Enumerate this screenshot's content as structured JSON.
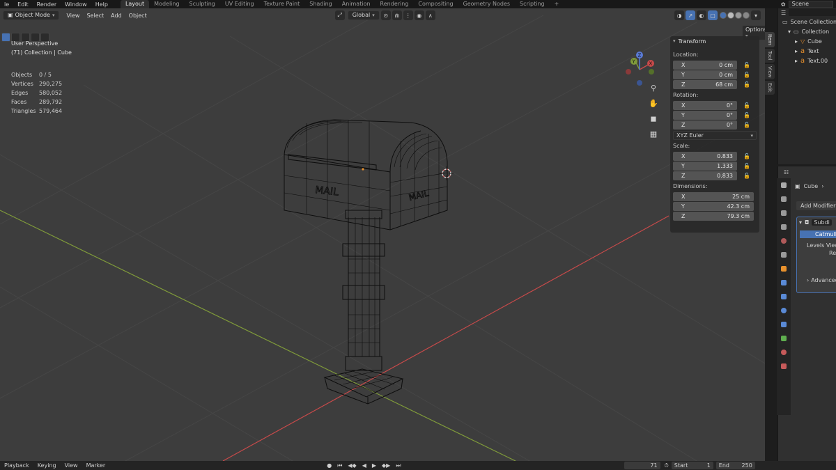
{
  "topbar": {
    "menus": [
      "le",
      "Edit",
      "Render",
      "Window",
      "Help"
    ],
    "workspaces": [
      "Layout",
      "Modeling",
      "Sculpting",
      "UV Editing",
      "Texture Paint",
      "Shading",
      "Animation",
      "Rendering",
      "Compositing",
      "Geometry Nodes",
      "Scripting"
    ],
    "active_workspace": "Layout",
    "add_tab": "+",
    "scene_label": "Scene"
  },
  "viewport_header": {
    "mode": "Object Mode",
    "menus": [
      "View",
      "Select",
      "Add",
      "Object"
    ],
    "orientation": "Global",
    "options": "Options"
  },
  "overlay": {
    "view_name": "User Perspective",
    "context": "(71) Collection | Cube",
    "stats": [
      {
        "label": "Objects",
        "value": "0 / 5"
      },
      {
        "label": "Vertices",
        "value": "290,275"
      },
      {
        "label": "Edges",
        "value": "580,052"
      },
      {
        "label": "Faces",
        "value": "289,792"
      },
      {
        "label": "Triangles",
        "value": "579,464"
      }
    ]
  },
  "model": {
    "label_left": "MAIL",
    "label_right": "MAIL"
  },
  "gizmo": {
    "x": "X",
    "y": "Y",
    "z": "Z"
  },
  "npanel": {
    "header": "Transform",
    "location_label": "Location:",
    "location": [
      {
        "axis": "X",
        "value": "0 cm"
      },
      {
        "axis": "Y",
        "value": "0 cm"
      },
      {
        "axis": "Z",
        "value": "68 cm"
      }
    ],
    "rotation_label": "Rotation:",
    "rotation": [
      {
        "axis": "X",
        "value": "0°"
      },
      {
        "axis": "Y",
        "value": "0°"
      },
      {
        "axis": "Z",
        "value": "0°"
      }
    ],
    "rotation_mode": "XYZ Euler",
    "scale_label": "Scale:",
    "scale": [
      {
        "axis": "X",
        "value": "0.833"
      },
      {
        "axis": "Y",
        "value": "1.333"
      },
      {
        "axis": "Z",
        "value": "0.833"
      }
    ],
    "dimensions_label": "Dimensions:",
    "dimensions": [
      {
        "axis": "X",
        "value": "25 cm"
      },
      {
        "axis": "Y",
        "value": "42.3 cm"
      },
      {
        "axis": "Z",
        "value": "79.3 cm"
      }
    ]
  },
  "side_tabs": [
    "Item",
    "Tool",
    "View",
    "Edit"
  ],
  "outliner": {
    "rows": [
      "Scene Collection",
      "Collection",
      "Cube",
      "Text",
      "Text.00"
    ]
  },
  "properties": {
    "object_name": "Cube",
    "add_modifier": "Add Modifier",
    "modifier_name": "Subdi",
    "catmull": "Catmull",
    "levels_view": "Levels View",
    "render_abbr": "Re",
    "advanced": "Advanced"
  },
  "timeline": {
    "menus": [
      "Playback",
      "Keying",
      "View",
      "Marker"
    ],
    "current_frame": "71",
    "start_label": "Start",
    "start_value": "1",
    "end_label": "End",
    "end_value": "250"
  },
  "colors": {
    "accent": "#4772b3",
    "x_axis": "#c74a4a",
    "y_axis": "#7f9a3a",
    "z_axis": "#5a7bd6",
    "wire": "#0d0d0d"
  }
}
